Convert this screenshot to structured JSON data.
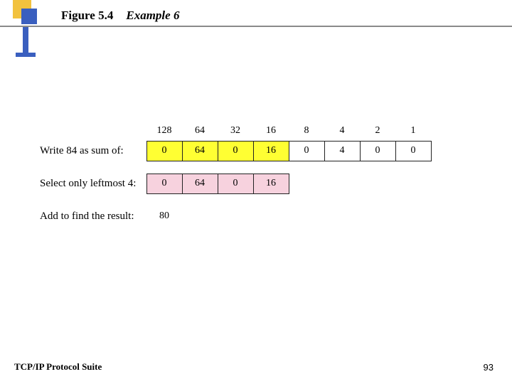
{
  "header": {
    "figure_label": "Figure 5.4",
    "example_label": "Example 6"
  },
  "chart_data": {
    "type": "table",
    "bit_weights": [
      128,
      64,
      32,
      16,
      8,
      4,
      2,
      1
    ],
    "row_labels": {
      "sum": "Write 84 as sum of:",
      "leftmost": "Select only leftmost 4:",
      "result": "Add to find the result:"
    },
    "sum_row": {
      "values": [
        0,
        64,
        0,
        16,
        0,
        4,
        0,
        0
      ],
      "highlight": [
        "yellow",
        "yellow",
        "yellow",
        "yellow",
        "",
        "",
        "",
        ""
      ]
    },
    "leftmost_row": {
      "values": [
        0,
        64,
        0,
        16
      ],
      "highlight": [
        "pink",
        "pink",
        "pink",
        "pink"
      ]
    },
    "result_value": 80
  },
  "footer": {
    "left": "TCP/IP Protocol Suite",
    "page": "93"
  }
}
